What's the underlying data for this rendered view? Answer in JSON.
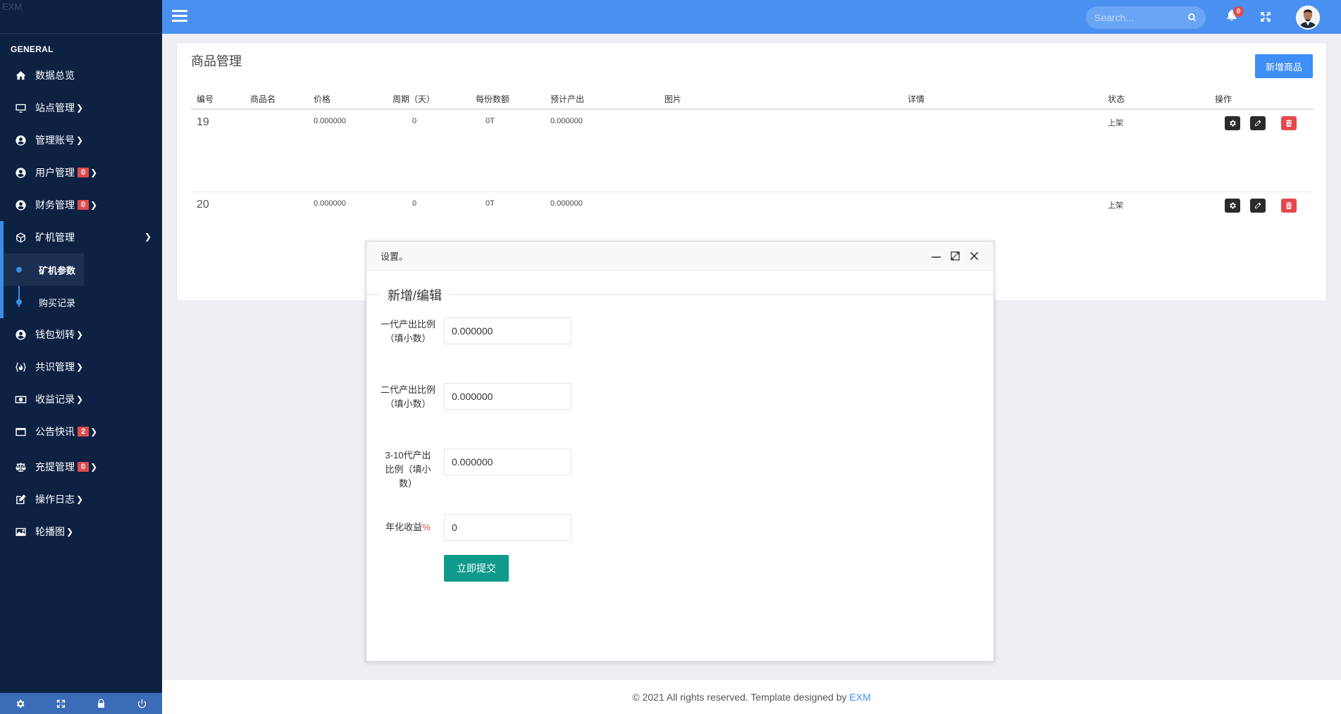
{
  "brand": "EXM",
  "sidebar": {
    "section": "GENERAL",
    "items": [
      {
        "label": "数据总览",
        "icon": "home-icon"
      },
      {
        "label": "站点管理",
        "icon": "monitor-icon"
      },
      {
        "label": "管理账号",
        "icon": "user-circle-icon"
      },
      {
        "label": "用户管理",
        "icon": "user-circle-icon",
        "badge": "0"
      },
      {
        "label": "财务管理",
        "icon": "user-circle-icon",
        "badge": "0"
      },
      {
        "label": "矿机管理",
        "icon": "cube-icon"
      },
      {
        "label": "钱包划转",
        "icon": "user-circle-icon"
      },
      {
        "label": "共识管理",
        "icon": "fire-icon"
      },
      {
        "label": "收益记录",
        "icon": "money-icon"
      },
      {
        "label": "公告快讯",
        "icon": "window-icon",
        "badge": "2"
      },
      {
        "label": "充提管理",
        "icon": "scale-icon",
        "badge": "0"
      },
      {
        "label": "操作日志",
        "icon": "edit-icon"
      },
      {
        "label": "轮播图",
        "icon": "image-icon"
      }
    ],
    "submenu": [
      "矿机参数",
      "购买记录"
    ]
  },
  "topbar": {
    "search_placeholder": "Search...",
    "notifications": "0"
  },
  "main": {
    "title": "商品管理",
    "add_button": "新增商品",
    "columns": [
      "编号",
      "商品名",
      "价格",
      "周期（天）",
      "每份数额",
      "预计产出",
      "图片",
      "详情",
      "状态",
      "操作"
    ],
    "rows": [
      {
        "id": "19",
        "name": "",
        "price": "0.000000",
        "cycle": "0",
        "amount": "0T",
        "output": "0.000000",
        "image": "",
        "detail": "",
        "status": "上架"
      },
      {
        "id": "20",
        "name": "",
        "price": "0.000000",
        "cycle": "0",
        "amount": "0T",
        "output": "0.000000",
        "image": "",
        "detail": "",
        "status": "上架"
      }
    ]
  },
  "modal": {
    "title": "设置。",
    "legend": "新增/编辑",
    "fields": [
      {
        "label": "一代产出比例（填小数）",
        "value": "0.000000"
      },
      {
        "label": "二代产出比例（填小数）",
        "value": "0.000000"
      },
      {
        "label": "3-10代产出比例（填小数）",
        "value": "0.000000"
      },
      {
        "label": "年化收益",
        "suffix": "%",
        "value": "0"
      }
    ],
    "submit": "立即提交"
  },
  "footer": {
    "text": "© 2021 All rights reserved. Template designed by ",
    "link": "EXM"
  }
}
